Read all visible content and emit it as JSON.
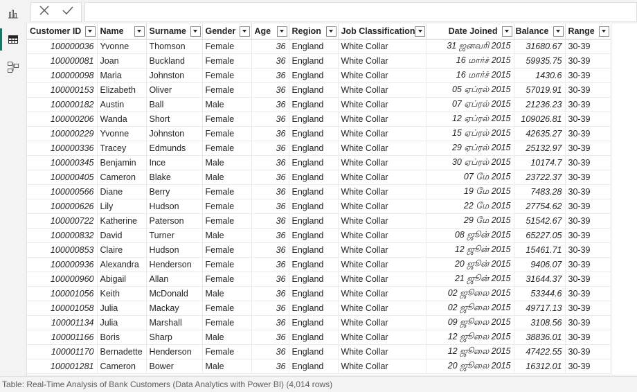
{
  "left_nav": {
    "items": [
      {
        "icon": "report-view-icon",
        "active": false
      },
      {
        "icon": "table-view-icon",
        "active": true
      },
      {
        "icon": "model-view-icon",
        "active": false
      }
    ]
  },
  "toolbar": {
    "cancel_icon": "close-icon",
    "commit_icon": "check-icon",
    "formula_value": ""
  },
  "table": {
    "columns": [
      {
        "label": "Customer ID",
        "key": "id"
      },
      {
        "label": "Name",
        "key": "name"
      },
      {
        "label": "Surname",
        "key": "surname"
      },
      {
        "label": "Gender",
        "key": "gender"
      },
      {
        "label": "Age",
        "key": "age"
      },
      {
        "label": "Region",
        "key": "region"
      },
      {
        "label": "Job Classification",
        "key": "job"
      },
      {
        "label": "Date Joined",
        "key": "date"
      },
      {
        "label": "Balance",
        "key": "balance"
      },
      {
        "label": "Range",
        "key": "range"
      }
    ],
    "rows": [
      [
        "100000036",
        "Yvonne",
        "Thomson",
        "Female",
        "36",
        "England",
        "White Collar",
        "31 ஜனவரி 2015",
        "31680.67",
        "30-39"
      ],
      [
        "100000081",
        "Joan",
        "Buckland",
        "Female",
        "36",
        "England",
        "White Collar",
        "16 மார்ச் 2015",
        "59935.75",
        "30-39"
      ],
      [
        "100000098",
        "Maria",
        "Johnston",
        "Female",
        "36",
        "England",
        "White Collar",
        "16 மார்ச் 2015",
        "1430.6",
        "30-39"
      ],
      [
        "100000153",
        "Elizabeth",
        "Oliver",
        "Female",
        "36",
        "England",
        "White Collar",
        "05 ஏப்ரல் 2015",
        "57019.91",
        "30-39"
      ],
      [
        "100000182",
        "Austin",
        "Ball",
        "Male",
        "36",
        "England",
        "White Collar",
        "07 ஏப்ரல் 2015",
        "21236.23",
        "30-39"
      ],
      [
        "100000206",
        "Wanda",
        "Short",
        "Female",
        "36",
        "England",
        "White Collar",
        "12 ஏப்ரல் 2015",
        "109026.81",
        "30-39"
      ],
      [
        "100000229",
        "Yvonne",
        "Johnston",
        "Female",
        "36",
        "England",
        "White Collar",
        "15 ஏப்ரல் 2015",
        "42635.27",
        "30-39"
      ],
      [
        "100000336",
        "Tracey",
        "Edmunds",
        "Female",
        "36",
        "England",
        "White Collar",
        "29 ஏப்ரல் 2015",
        "25132.97",
        "30-39"
      ],
      [
        "100000345",
        "Benjamin",
        "Ince",
        "Male",
        "36",
        "England",
        "White Collar",
        "30 ஏப்ரல் 2015",
        "10174.7",
        "30-39"
      ],
      [
        "100000405",
        "Cameron",
        "Blake",
        "Male",
        "36",
        "England",
        "White Collar",
        "07 மே 2015",
        "23722.37",
        "30-39"
      ],
      [
        "100000566",
        "Diane",
        "Berry",
        "Female",
        "36",
        "England",
        "White Collar",
        "19 மே 2015",
        "7483.28",
        "30-39"
      ],
      [
        "100000626",
        "Lily",
        "Hudson",
        "Female",
        "36",
        "England",
        "White Collar",
        "22 மே 2015",
        "27754.62",
        "30-39"
      ],
      [
        "100000722",
        "Katherine",
        "Paterson",
        "Female",
        "36",
        "England",
        "White Collar",
        "29 மே 2015",
        "51542.67",
        "30-39"
      ],
      [
        "100000832",
        "David",
        "Turner",
        "Male",
        "36",
        "England",
        "White Collar",
        "08 ஜூன் 2015",
        "65227.05",
        "30-39"
      ],
      [
        "100000853",
        "Claire",
        "Hudson",
        "Female",
        "36",
        "England",
        "White Collar",
        "12 ஜூன் 2015",
        "15461.71",
        "30-39"
      ],
      [
        "100000936",
        "Alexandra",
        "Henderson",
        "Female",
        "36",
        "England",
        "White Collar",
        "20 ஜூன் 2015",
        "9406.07",
        "30-39"
      ],
      [
        "100000960",
        "Abigail",
        "Allan",
        "Female",
        "36",
        "England",
        "White Collar",
        "21 ஜூன் 2015",
        "31644.37",
        "30-39"
      ],
      [
        "100001056",
        "Keith",
        "McDonald",
        "Male",
        "36",
        "England",
        "White Collar",
        "02 ஜூலை 2015",
        "53344.6",
        "30-39"
      ],
      [
        "100001058",
        "Julia",
        "Mackay",
        "Female",
        "36",
        "England",
        "White Collar",
        "02 ஜூலை 2015",
        "49717.13",
        "30-39"
      ],
      [
        "100001134",
        "Julia",
        "Marshall",
        "Female",
        "36",
        "England",
        "White Collar",
        "09 ஜூலை 2015",
        "3108.56",
        "30-39"
      ],
      [
        "100001166",
        "Boris",
        "Sharp",
        "Male",
        "36",
        "England",
        "White Collar",
        "12 ஜூலை 2015",
        "38836.01",
        "30-39"
      ],
      [
        "100001170",
        "Bernadette",
        "Henderson",
        "Female",
        "36",
        "England",
        "White Collar",
        "12 ஜூலை 2015",
        "47422.55",
        "30-39"
      ],
      [
        "100001281",
        "Cameron",
        "Bower",
        "Male",
        "36",
        "England",
        "White Collar",
        "20 ஜூலை 2015",
        "16312.01",
        "30-39"
      ]
    ]
  },
  "status_bar": {
    "text": "Table: Real-Time Analysis of Bank Customers (Data Analytics with Power BI) (4,014 rows)"
  }
}
